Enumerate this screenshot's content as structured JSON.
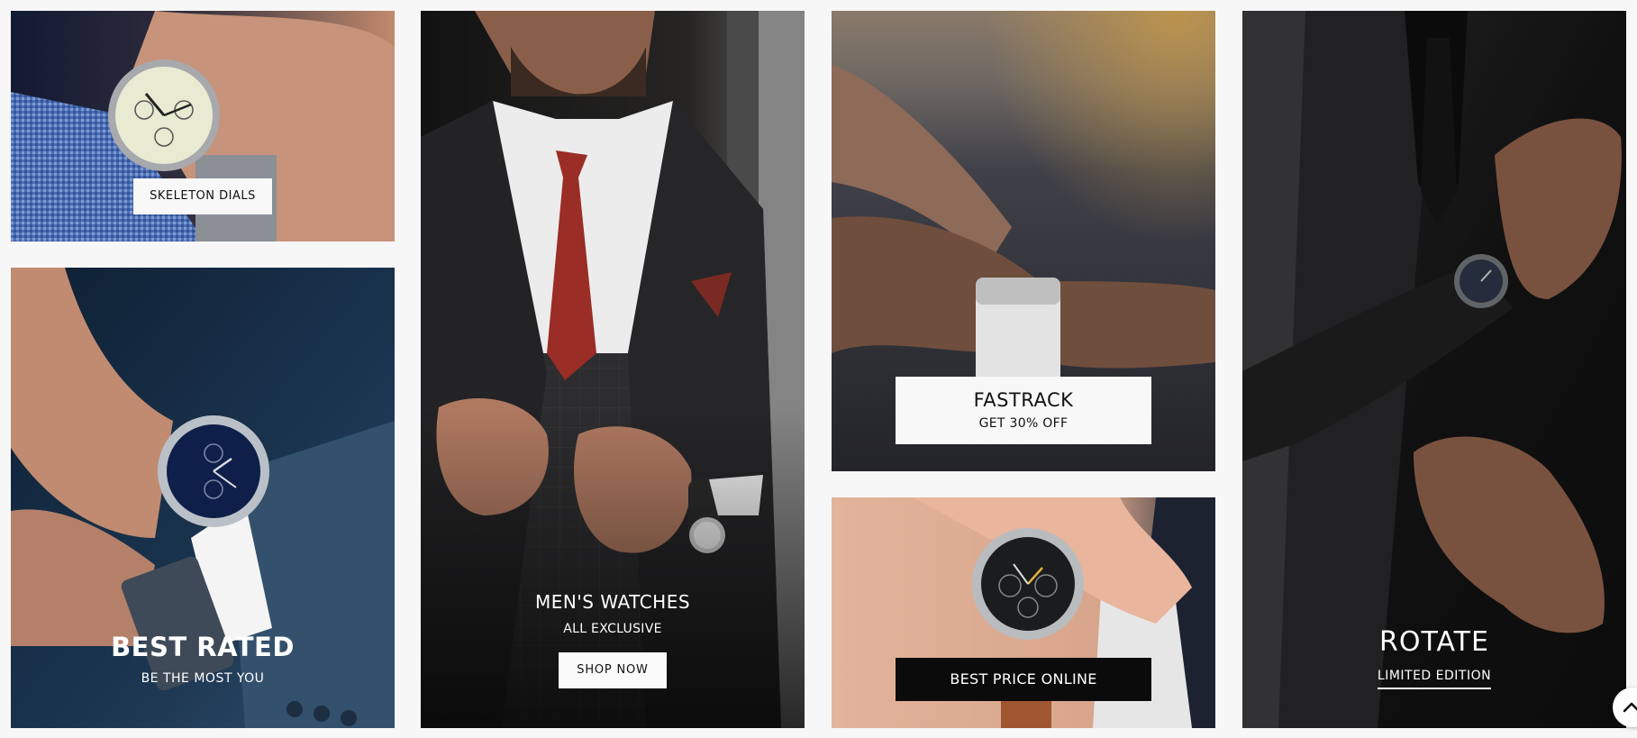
{
  "tiles": {
    "skeleton": {
      "label": "SKELETON DIALS"
    },
    "best_rated": {
      "title": "BEST RATED",
      "subtitle": "BE THE MOST YOU"
    },
    "mens": {
      "title": "MEN'S WATCHES",
      "subtitle": "ALL EXCLUSIVE",
      "button": "SHOP NOW"
    },
    "fastrack": {
      "title": "FASTRACK",
      "subtitle": "GET 30% OFF"
    },
    "best_price": {
      "button": "BEST PRICE ONLINE"
    },
    "rotate": {
      "title": "ROTATE",
      "subtitle": "LIMITED EDITION"
    }
  },
  "icons": {
    "scroll_top": "chevron-up-icon"
  }
}
